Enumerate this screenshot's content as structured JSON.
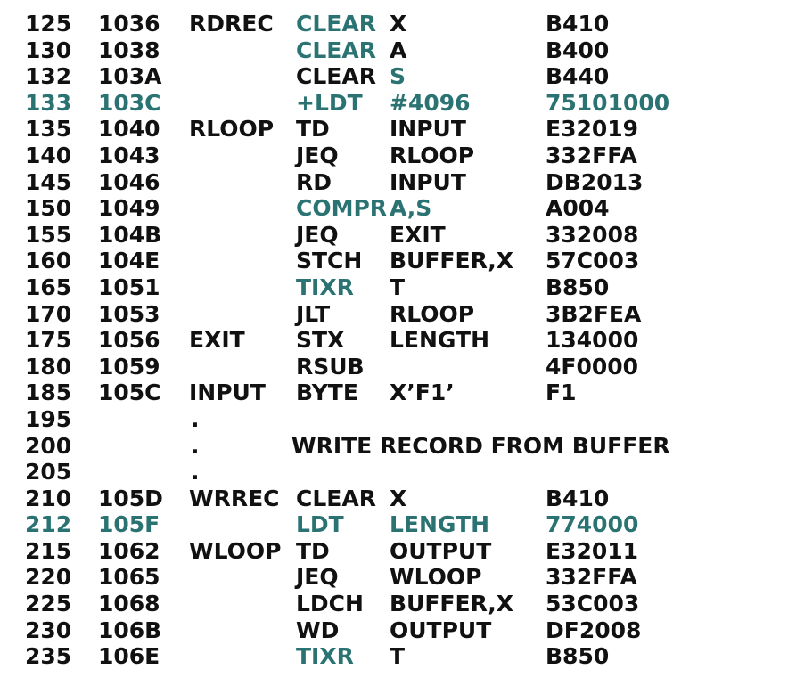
{
  "colors": {
    "text": "#111111",
    "highlight": "#2b7373",
    "background": "#ffffff"
  },
  "rows": [
    {
      "line": "125",
      "loc": "1036",
      "label": "RDREC",
      "op": "CLEAR",
      "operand": "X",
      "obj": "B410",
      "hl_row": false,
      "hl_op": true,
      "hl_operand": false
    },
    {
      "line": "130",
      "loc": "1038",
      "label": "",
      "op": "CLEAR",
      "operand": "A",
      "obj": "B400",
      "hl_row": false,
      "hl_op": true,
      "hl_operand": false
    },
    {
      "line": "132",
      "loc": "103A",
      "label": "",
      "op": "CLEAR",
      "operand": "S",
      "obj": "B440",
      "hl_row": false,
      "hl_op": false,
      "hl_operand": true
    },
    {
      "line": "133",
      "loc": "103C",
      "label": "",
      "op": "+LDT",
      "operand": "#4096",
      "obj": "75101000",
      "hl_row": true,
      "hl_op": false,
      "hl_operand": false
    },
    {
      "line": "135",
      "loc": "1040",
      "label": "RLOOP",
      "op": "TD",
      "operand": "INPUT",
      "obj": "E32019",
      "hl_row": false,
      "hl_op": false,
      "hl_operand": false
    },
    {
      "line": "140",
      "loc": "1043",
      "label": "",
      "op": "JEQ",
      "operand": "RLOOP",
      "obj": "332FFA",
      "hl_row": false,
      "hl_op": false,
      "hl_operand": false
    },
    {
      "line": "145",
      "loc": "1046",
      "label": "",
      "op": "RD",
      "operand": "INPUT",
      "obj": "DB2013",
      "hl_row": false,
      "hl_op": false,
      "hl_operand": false
    },
    {
      "line": "150",
      "loc": "1049",
      "label": "",
      "op": "COMPR",
      "operand": "A,S",
      "obj": "A004",
      "hl_row": false,
      "hl_op": true,
      "hl_operand": true
    },
    {
      "line": "155",
      "loc": "104B",
      "label": "",
      "op": "JEQ",
      "operand": "EXIT",
      "obj": "332008",
      "hl_row": false,
      "hl_op": false,
      "hl_operand": false
    },
    {
      "line": "160",
      "loc": "104E",
      "label": "",
      "op": "STCH",
      "operand": "BUFFER,X",
      "obj": "57C003",
      "hl_row": false,
      "hl_op": false,
      "hl_operand": false
    },
    {
      "line": "165",
      "loc": "1051",
      "label": "",
      "op": "TIXR",
      "operand": "T",
      "obj": "B850",
      "hl_row": false,
      "hl_op": true,
      "hl_operand": false
    },
    {
      "line": "170",
      "loc": "1053",
      "label": "",
      "op": "JLT",
      "operand": "RLOOP",
      "obj": "3B2FEA",
      "hl_row": false,
      "hl_op": false,
      "hl_operand": false
    },
    {
      "line": "175",
      "loc": "1056",
      "label": "EXIT",
      "op": "STX",
      "operand": "LENGTH",
      "obj": "134000",
      "hl_row": false,
      "hl_op": false,
      "hl_operand": false
    },
    {
      "line": "180",
      "loc": "1059",
      "label": "",
      "op": "RSUB",
      "operand": "",
      "obj": "4F0000",
      "hl_row": false,
      "hl_op": false,
      "hl_operand": false
    },
    {
      "line": "185",
      "loc": "105C",
      "label": "INPUT",
      "op": "BYTE",
      "operand": "X’F1’",
      "obj": "F1",
      "hl_row": false,
      "hl_op": false,
      "hl_operand": false
    },
    {
      "line": "195",
      "dot": ".",
      "comment": ""
    },
    {
      "line": "200",
      "dot": ".",
      "comment": "WRITE RECORD FROM BUFFER"
    },
    {
      "line": "205",
      "dot": ".",
      "comment": ""
    },
    {
      "line": "210",
      "loc": "105D",
      "label": "WRREC",
      "op": "CLEAR",
      "operand": "X",
      "obj": "B410",
      "hl_row": false,
      "hl_op": false,
      "hl_operand": false
    },
    {
      "line": "212",
      "loc": "105F",
      "label": "",
      "op": "LDT",
      "operand": "LENGTH",
      "obj": "774000",
      "hl_row": true,
      "hl_op": false,
      "hl_operand": false
    },
    {
      "line": "215",
      "loc": "1062",
      "label": "WLOOP",
      "op": "TD",
      "operand": "OUTPUT",
      "obj": "E32011",
      "hl_row": false,
      "hl_op": false,
      "hl_operand": false
    },
    {
      "line": "220",
      "loc": "1065",
      "label": "",
      "op": "JEQ",
      "operand": "WLOOP",
      "obj": "332FFA",
      "hl_row": false,
      "hl_op": false,
      "hl_operand": false
    },
    {
      "line": "225",
      "loc": "1068",
      "label": "",
      "op": "LDCH",
      "operand": "BUFFER,X",
      "obj": "53C003",
      "hl_row": false,
      "hl_op": false,
      "hl_operand": false
    },
    {
      "line": "230",
      "loc": "106B",
      "label": "",
      "op": "WD",
      "operand": "OUTPUT",
      "obj": "DF2008",
      "hl_row": false,
      "hl_op": false,
      "hl_operand": false
    },
    {
      "line": "235",
      "loc": "106E",
      "label": "",
      "op": "TIXR",
      "operand": "T",
      "obj": "B850",
      "hl_row": false,
      "hl_op": true,
      "hl_operand": false
    }
  ]
}
